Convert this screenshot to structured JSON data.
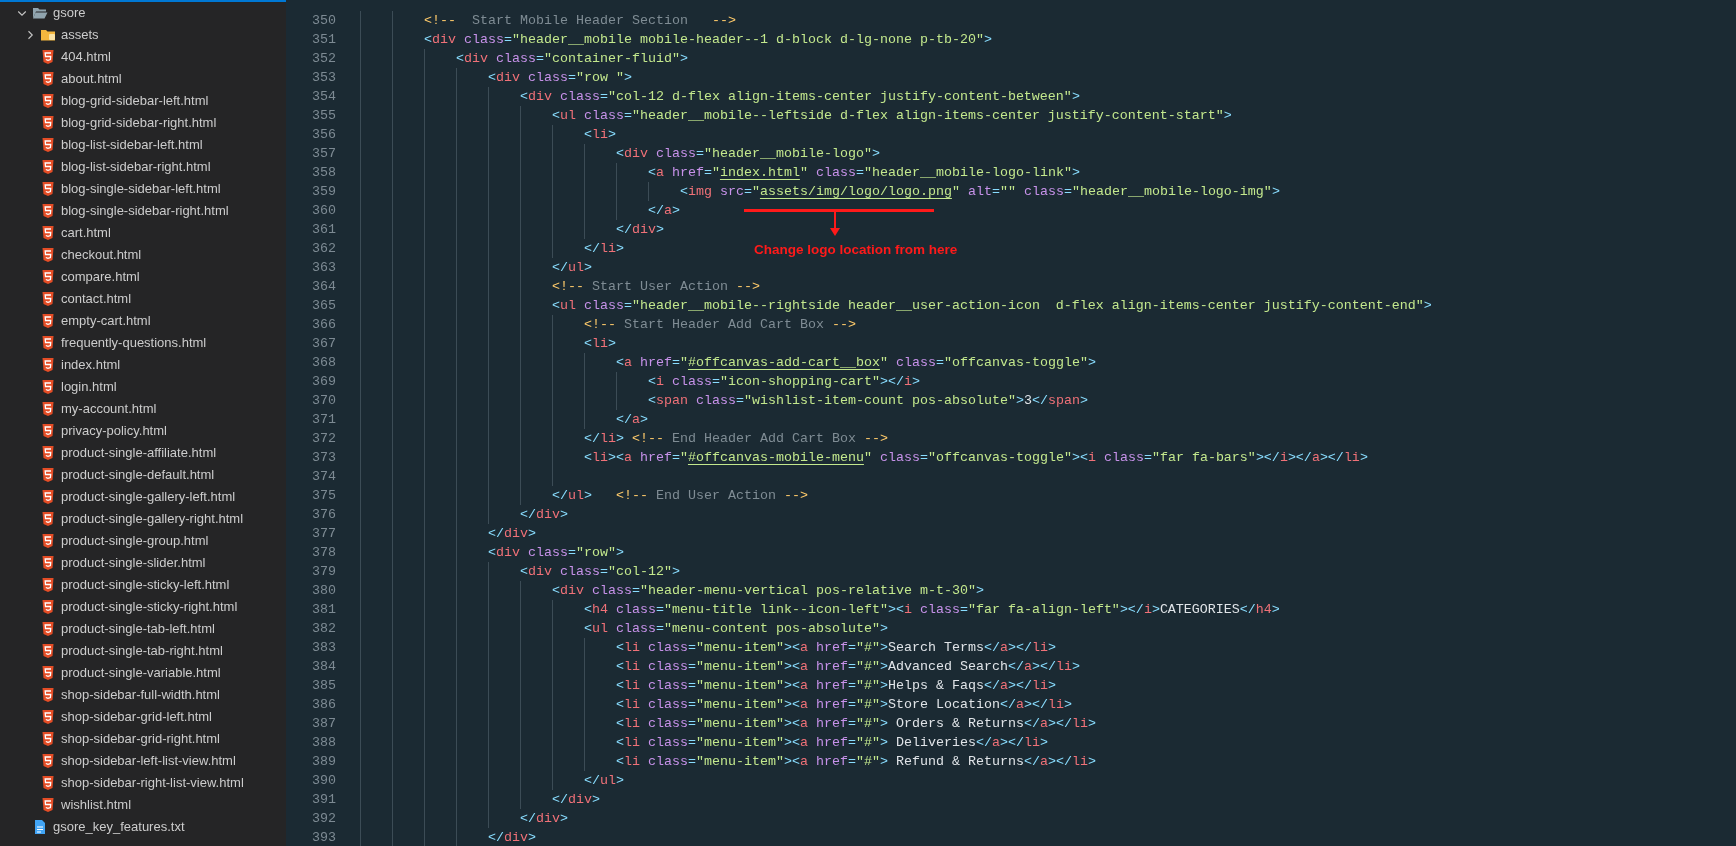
{
  "explorer": {
    "items": [
      {
        "kind": "folder",
        "label": "gsore",
        "expanded": true,
        "children": [
          {
            "kind": "folder",
            "label": "assets",
            "expanded": false
          },
          {
            "kind": "html",
            "label": "404.html"
          },
          {
            "kind": "html",
            "label": "about.html"
          },
          {
            "kind": "html",
            "label": "blog-grid-sidebar-left.html"
          },
          {
            "kind": "html",
            "label": "blog-grid-sidebar-right.html"
          },
          {
            "kind": "html",
            "label": "blog-list-sidebar-left.html"
          },
          {
            "kind": "html",
            "label": "blog-list-sidebar-right.html"
          },
          {
            "kind": "html",
            "label": "blog-single-sidebar-left.html"
          },
          {
            "kind": "html",
            "label": "blog-single-sidebar-right.html"
          },
          {
            "kind": "html",
            "label": "cart.html"
          },
          {
            "kind": "html",
            "label": "checkout.html"
          },
          {
            "kind": "html",
            "label": "compare.html"
          },
          {
            "kind": "html",
            "label": "contact.html"
          },
          {
            "kind": "html",
            "label": "empty-cart.html"
          },
          {
            "kind": "html",
            "label": "frequently-questions.html"
          },
          {
            "kind": "html",
            "label": "index.html"
          },
          {
            "kind": "html",
            "label": "login.html"
          },
          {
            "kind": "html",
            "label": "my-account.html"
          },
          {
            "kind": "html",
            "label": "privacy-policy.html"
          },
          {
            "kind": "html",
            "label": "product-single-affiliate.html"
          },
          {
            "kind": "html",
            "label": "product-single-default.html"
          },
          {
            "kind": "html",
            "label": "product-single-gallery-left.html"
          },
          {
            "kind": "html",
            "label": "product-single-gallery-right.html"
          },
          {
            "kind": "html",
            "label": "product-single-group.html"
          },
          {
            "kind": "html",
            "label": "product-single-slider.html"
          },
          {
            "kind": "html",
            "label": "product-single-sticky-left.html"
          },
          {
            "kind": "html",
            "label": "product-single-sticky-right.html"
          },
          {
            "kind": "html",
            "label": "product-single-tab-left.html"
          },
          {
            "kind": "html",
            "label": "product-single-tab-right.html"
          },
          {
            "kind": "html",
            "label": "product-single-variable.html"
          },
          {
            "kind": "html",
            "label": "shop-sidebar-full-width.html"
          },
          {
            "kind": "html",
            "label": "shop-sidebar-grid-left.html"
          },
          {
            "kind": "html",
            "label": "shop-sidebar-grid-right.html"
          },
          {
            "kind": "html",
            "label": "shop-sidebar-left-list-view.html"
          },
          {
            "kind": "html",
            "label": "shop-sidebar-right-list-view.html"
          },
          {
            "kind": "html",
            "label": "wishlist.html"
          }
        ]
      },
      {
        "kind": "text",
        "label": "gsore_key_features.txt"
      }
    ]
  },
  "editor": {
    "lines": [
      {
        "number": "350",
        "code": [
          {
            "kind": "c",
            "text": "        <!--"
          },
          {
            "kind": "ct",
            "text": "  Start Mobile Header Section   "
          },
          {
            "kind": "c",
            "text": "-->"
          }
        ]
      },
      {
        "number": "351",
        "code": [
          {
            "kind": "p",
            "text": "        <"
          },
          {
            "kind": "t",
            "text": "div"
          },
          {
            "kind": "a",
            "text": " class"
          },
          {
            "kind": "p",
            "text": "="
          },
          {
            "kind": "s",
            "text": "\"header__mobile mobile-header--1 d-block d-lg-none p-tb-20\""
          },
          {
            "kind": "p",
            "text": ">"
          }
        ]
      },
      {
        "number": "352",
        "code": [
          {
            "kind": "p",
            "text": "            <"
          },
          {
            "kind": "t",
            "text": "div"
          },
          {
            "kind": "a",
            "text": " class"
          },
          {
            "kind": "p",
            "text": "="
          },
          {
            "kind": "s",
            "text": "\"container-fluid\""
          },
          {
            "kind": "p",
            "text": ">"
          }
        ]
      },
      {
        "number": "353",
        "code": [
          {
            "kind": "p",
            "text": "                <"
          },
          {
            "kind": "t",
            "text": "div"
          },
          {
            "kind": "a",
            "text": " class"
          },
          {
            "kind": "p",
            "text": "="
          },
          {
            "kind": "s",
            "text": "\"row \""
          },
          {
            "kind": "p",
            "text": ">"
          }
        ]
      },
      {
        "number": "354",
        "code": [
          {
            "kind": "p",
            "text": "                    <"
          },
          {
            "kind": "t",
            "text": "div"
          },
          {
            "kind": "a",
            "text": " class"
          },
          {
            "kind": "p",
            "text": "="
          },
          {
            "kind": "s",
            "text": "\"col-12 d-flex align-items-center justify-content-between\""
          },
          {
            "kind": "p",
            "text": ">"
          }
        ]
      },
      {
        "number": "355",
        "code": [
          {
            "kind": "p",
            "text": "                        <"
          },
          {
            "kind": "t",
            "text": "ul"
          },
          {
            "kind": "a",
            "text": " class"
          },
          {
            "kind": "p",
            "text": "="
          },
          {
            "kind": "s",
            "text": "\"header__mobile--leftside d-flex align-items-center justify-content-start\""
          },
          {
            "kind": "p",
            "text": ">"
          }
        ]
      },
      {
        "number": "356",
        "code": [
          {
            "kind": "p",
            "text": "                            <"
          },
          {
            "kind": "t",
            "text": "li"
          },
          {
            "kind": "p",
            "text": ">"
          }
        ]
      },
      {
        "number": "357",
        "code": [
          {
            "kind": "p",
            "text": "                                <"
          },
          {
            "kind": "t",
            "text": "div"
          },
          {
            "kind": "a",
            "text": " class"
          },
          {
            "kind": "p",
            "text": "="
          },
          {
            "kind": "s",
            "text": "\"header__mobile-logo\""
          },
          {
            "kind": "p",
            "text": ">"
          }
        ]
      },
      {
        "number": "358",
        "code": [
          {
            "kind": "p",
            "text": "                                    <"
          },
          {
            "kind": "t",
            "text": "a"
          },
          {
            "kind": "a",
            "text": " href"
          },
          {
            "kind": "p",
            "text": "="
          },
          {
            "kind": "s",
            "text": "\""
          },
          {
            "kind": "u",
            "text": "index.html"
          },
          {
            "kind": "s",
            "text": "\""
          },
          {
            "kind": "a",
            "text": " class"
          },
          {
            "kind": "p",
            "text": "="
          },
          {
            "kind": "s",
            "text": "\"header__mobile-logo-link\""
          },
          {
            "kind": "p",
            "text": ">"
          }
        ]
      },
      {
        "number": "359",
        "code": [
          {
            "kind": "p",
            "text": "                                        <"
          },
          {
            "kind": "t",
            "text": "img"
          },
          {
            "kind": "a",
            "text": " src"
          },
          {
            "kind": "p",
            "text": "="
          },
          {
            "kind": "s",
            "text": "\""
          },
          {
            "kind": "u",
            "text": "assets/img/logo/logo.png"
          },
          {
            "kind": "s",
            "text": "\""
          },
          {
            "kind": "a",
            "text": " alt"
          },
          {
            "kind": "p",
            "text": "="
          },
          {
            "kind": "s",
            "text": "\"\""
          },
          {
            "kind": "a",
            "text": " class"
          },
          {
            "kind": "p",
            "text": "="
          },
          {
            "kind": "s",
            "text": "\"header__mobile-logo-img\""
          },
          {
            "kind": "p",
            "text": ">"
          }
        ]
      },
      {
        "number": "360",
        "code": [
          {
            "kind": "p",
            "text": "                                    </"
          },
          {
            "kind": "t",
            "text": "a"
          },
          {
            "kind": "p",
            "text": ">"
          }
        ]
      },
      {
        "number": "361",
        "code": [
          {
            "kind": "p",
            "text": "                                </"
          },
          {
            "kind": "t",
            "text": "div"
          },
          {
            "kind": "p",
            "text": ">"
          }
        ]
      },
      {
        "number": "362",
        "code": [
          {
            "kind": "p",
            "text": "                            </"
          },
          {
            "kind": "t",
            "text": "li"
          },
          {
            "kind": "p",
            "text": ">"
          }
        ]
      },
      {
        "number": "363",
        "code": [
          {
            "kind": "p",
            "text": "                        </"
          },
          {
            "kind": "t",
            "text": "ul"
          },
          {
            "kind": "p",
            "text": ">"
          }
        ]
      },
      {
        "number": "364",
        "code": [
          {
            "kind": "c",
            "text": "                        <!--"
          },
          {
            "kind": "ct",
            "text": " Start User Action "
          },
          {
            "kind": "c",
            "text": "-->"
          }
        ]
      },
      {
        "number": "365",
        "code": [
          {
            "kind": "p",
            "text": "                        <"
          },
          {
            "kind": "t",
            "text": "ul"
          },
          {
            "kind": "a",
            "text": " class"
          },
          {
            "kind": "p",
            "text": "="
          },
          {
            "kind": "s",
            "text": "\"header__mobile--rightside header__user-action-icon  d-flex align-items-center justify-content-end\""
          },
          {
            "kind": "p",
            "text": ">"
          }
        ]
      },
      {
        "number": "366",
        "code": [
          {
            "kind": "c",
            "text": "                            <!--"
          },
          {
            "kind": "ct",
            "text": " Start Header Add Cart Box "
          },
          {
            "kind": "c",
            "text": "-->"
          }
        ]
      },
      {
        "number": "367",
        "code": [
          {
            "kind": "p",
            "text": "                            <"
          },
          {
            "kind": "t",
            "text": "li"
          },
          {
            "kind": "p",
            "text": ">"
          }
        ]
      },
      {
        "number": "368",
        "code": [
          {
            "kind": "p",
            "text": "                                <"
          },
          {
            "kind": "t",
            "text": "a"
          },
          {
            "kind": "a",
            "text": " href"
          },
          {
            "kind": "p",
            "text": "="
          },
          {
            "kind": "s",
            "text": "\""
          },
          {
            "kind": "u",
            "text": "#offcanvas-add-cart__box"
          },
          {
            "kind": "s",
            "text": "\""
          },
          {
            "kind": "a",
            "text": " class"
          },
          {
            "kind": "p",
            "text": "="
          },
          {
            "kind": "s",
            "text": "\"offcanvas-toggle\""
          },
          {
            "kind": "p",
            "text": ">"
          }
        ]
      },
      {
        "number": "369",
        "code": [
          {
            "kind": "p",
            "text": "                                    <"
          },
          {
            "kind": "t",
            "text": "i"
          },
          {
            "kind": "a",
            "text": " class"
          },
          {
            "kind": "p",
            "text": "="
          },
          {
            "kind": "s",
            "text": "\"icon-shopping-cart\""
          },
          {
            "kind": "p",
            "text": "></"
          },
          {
            "kind": "t",
            "text": "i"
          },
          {
            "kind": "p",
            "text": ">"
          }
        ]
      },
      {
        "number": "370",
        "code": [
          {
            "kind": "p",
            "text": "                                    <"
          },
          {
            "kind": "t",
            "text": "span"
          },
          {
            "kind": "a",
            "text": " class"
          },
          {
            "kind": "p",
            "text": "="
          },
          {
            "kind": "s",
            "text": "\"wishlist-item-count pos-absolute\""
          },
          {
            "kind": "p",
            "text": ">"
          },
          {
            "kind": "x",
            "text": "3"
          },
          {
            "kind": "p",
            "text": "</"
          },
          {
            "kind": "t",
            "text": "span"
          },
          {
            "kind": "p",
            "text": ">"
          }
        ]
      },
      {
        "number": "371",
        "code": [
          {
            "kind": "p",
            "text": "                                </"
          },
          {
            "kind": "t",
            "text": "a"
          },
          {
            "kind": "p",
            "text": ">"
          }
        ]
      },
      {
        "number": "372",
        "code": [
          {
            "kind": "p",
            "text": "                            </"
          },
          {
            "kind": "t",
            "text": "li"
          },
          {
            "kind": "p",
            "text": "> "
          },
          {
            "kind": "c",
            "text": "<!--"
          },
          {
            "kind": "ct",
            "text": " End Header Add Cart Box "
          },
          {
            "kind": "c",
            "text": "-->"
          }
        ]
      },
      {
        "number": "373",
        "code": [
          {
            "kind": "p",
            "text": "                            <"
          },
          {
            "kind": "t",
            "text": "li"
          },
          {
            "kind": "p",
            "text": "><"
          },
          {
            "kind": "t",
            "text": "a"
          },
          {
            "kind": "a",
            "text": " href"
          },
          {
            "kind": "p",
            "text": "="
          },
          {
            "kind": "s",
            "text": "\""
          },
          {
            "kind": "u",
            "text": "#offcanvas-mobile-menu"
          },
          {
            "kind": "s",
            "text": "\""
          },
          {
            "kind": "a",
            "text": " class"
          },
          {
            "kind": "p",
            "text": "="
          },
          {
            "kind": "s",
            "text": "\"offcanvas-toggle\""
          },
          {
            "kind": "p",
            "text": "><"
          },
          {
            "kind": "t",
            "text": "i"
          },
          {
            "kind": "a",
            "text": " class"
          },
          {
            "kind": "p",
            "text": "="
          },
          {
            "kind": "s",
            "text": "\"far fa-bars\""
          },
          {
            "kind": "p",
            "text": "></"
          },
          {
            "kind": "t",
            "text": "i"
          },
          {
            "kind": "p",
            "text": "></"
          },
          {
            "kind": "t",
            "text": "a"
          },
          {
            "kind": "p",
            "text": "></"
          },
          {
            "kind": "t",
            "text": "li"
          },
          {
            "kind": "p",
            "text": ">"
          }
        ]
      },
      {
        "number": "374"
      },
      {
        "number": "375",
        "code": [
          {
            "kind": "p",
            "text": "                        </"
          },
          {
            "kind": "t",
            "text": "ul"
          },
          {
            "kind": "p",
            "text": ">   "
          },
          {
            "kind": "c",
            "text": "<!--"
          },
          {
            "kind": "ct",
            "text": " End User Action "
          },
          {
            "kind": "c",
            "text": "-->"
          }
        ]
      },
      {
        "number": "376",
        "code": [
          {
            "kind": "p",
            "text": "                    </"
          },
          {
            "kind": "t",
            "text": "div"
          },
          {
            "kind": "p",
            "text": ">"
          }
        ]
      },
      {
        "number": "377",
        "code": [
          {
            "kind": "p",
            "text": "                </"
          },
          {
            "kind": "t",
            "text": "div"
          },
          {
            "kind": "p",
            "text": ">"
          }
        ]
      },
      {
        "number": "378",
        "code": [
          {
            "kind": "p",
            "text": "                <"
          },
          {
            "kind": "t",
            "text": "div"
          },
          {
            "kind": "a",
            "text": " class"
          },
          {
            "kind": "p",
            "text": "="
          },
          {
            "kind": "s",
            "text": "\"row\""
          },
          {
            "kind": "p",
            "text": ">"
          }
        ]
      },
      {
        "number": "379",
        "code": [
          {
            "kind": "p",
            "text": "                    <"
          },
          {
            "kind": "t",
            "text": "div"
          },
          {
            "kind": "a",
            "text": " class"
          },
          {
            "kind": "p",
            "text": "="
          },
          {
            "kind": "s",
            "text": "\"col-12\""
          },
          {
            "kind": "p",
            "text": ">"
          }
        ]
      },
      {
        "number": "380",
        "code": [
          {
            "kind": "p",
            "text": "                        <"
          },
          {
            "kind": "t",
            "text": "div"
          },
          {
            "kind": "a",
            "text": " class"
          },
          {
            "kind": "p",
            "text": "="
          },
          {
            "kind": "s",
            "text": "\"header-menu-vertical pos-relative m-t-30\""
          },
          {
            "kind": "p",
            "text": ">"
          }
        ]
      },
      {
        "number": "381",
        "code": [
          {
            "kind": "p",
            "text": "                            <"
          },
          {
            "kind": "t",
            "text": "h4"
          },
          {
            "kind": "a",
            "text": " class"
          },
          {
            "kind": "p",
            "text": "="
          },
          {
            "kind": "s",
            "text": "\"menu-title link--icon-left\""
          },
          {
            "kind": "p",
            "text": "><"
          },
          {
            "kind": "t",
            "text": "i"
          },
          {
            "kind": "a",
            "text": " class"
          },
          {
            "kind": "p",
            "text": "="
          },
          {
            "kind": "s",
            "text": "\"far fa-align-left\""
          },
          {
            "kind": "p",
            "text": "></"
          },
          {
            "kind": "t",
            "text": "i"
          },
          {
            "kind": "p",
            "text": ">"
          },
          {
            "kind": "x",
            "text": "CATEGORIES"
          },
          {
            "kind": "p",
            "text": "</"
          },
          {
            "kind": "t",
            "text": "h4"
          },
          {
            "kind": "p",
            "text": ">"
          }
        ]
      },
      {
        "number": "382",
        "code": [
          {
            "kind": "p",
            "text": "                            <"
          },
          {
            "kind": "t",
            "text": "ul"
          },
          {
            "kind": "a",
            "text": " class"
          },
          {
            "kind": "p",
            "text": "="
          },
          {
            "kind": "s",
            "text": "\"menu-content pos-absolute\""
          },
          {
            "kind": "p",
            "text": ">"
          }
        ]
      },
      {
        "number": "383",
        "code": [
          {
            "kind": "p",
            "text": "                                <"
          },
          {
            "kind": "t",
            "text": "li"
          },
          {
            "kind": "a",
            "text": " class"
          },
          {
            "kind": "p",
            "text": "="
          },
          {
            "kind": "s",
            "text": "\"menu-item\""
          },
          {
            "kind": "p",
            "text": "><"
          },
          {
            "kind": "t",
            "text": "a"
          },
          {
            "kind": "a",
            "text": " href"
          },
          {
            "kind": "p",
            "text": "="
          },
          {
            "kind": "s",
            "text": "\"#\""
          },
          {
            "kind": "p",
            "text": ">"
          },
          {
            "kind": "x",
            "text": "Search Terms"
          },
          {
            "kind": "p",
            "text": "</"
          },
          {
            "kind": "t",
            "text": "a"
          },
          {
            "kind": "p",
            "text": "></"
          },
          {
            "kind": "t",
            "text": "li"
          },
          {
            "kind": "p",
            "text": ">"
          }
        ]
      },
      {
        "number": "384",
        "code": [
          {
            "kind": "p",
            "text": "                                <"
          },
          {
            "kind": "t",
            "text": "li"
          },
          {
            "kind": "a",
            "text": " class"
          },
          {
            "kind": "p",
            "text": "="
          },
          {
            "kind": "s",
            "text": "\"menu-item\""
          },
          {
            "kind": "p",
            "text": "><"
          },
          {
            "kind": "t",
            "text": "a"
          },
          {
            "kind": "a",
            "text": " href"
          },
          {
            "kind": "p",
            "text": "="
          },
          {
            "kind": "s",
            "text": "\"#\""
          },
          {
            "kind": "p",
            "text": ">"
          },
          {
            "kind": "x",
            "text": "Advanced Search"
          },
          {
            "kind": "p",
            "text": "</"
          },
          {
            "kind": "t",
            "text": "a"
          },
          {
            "kind": "p",
            "text": "></"
          },
          {
            "kind": "t",
            "text": "li"
          },
          {
            "kind": "p",
            "text": ">"
          }
        ]
      },
      {
        "number": "385",
        "code": [
          {
            "kind": "p",
            "text": "                                <"
          },
          {
            "kind": "t",
            "text": "li"
          },
          {
            "kind": "a",
            "text": " class"
          },
          {
            "kind": "p",
            "text": "="
          },
          {
            "kind": "s",
            "text": "\"menu-item\""
          },
          {
            "kind": "p",
            "text": "><"
          },
          {
            "kind": "t",
            "text": "a"
          },
          {
            "kind": "a",
            "text": " href"
          },
          {
            "kind": "p",
            "text": "="
          },
          {
            "kind": "s",
            "text": "\"#\""
          },
          {
            "kind": "p",
            "text": ">"
          },
          {
            "kind": "x",
            "text": "Helps & Faqs"
          },
          {
            "kind": "p",
            "text": "</"
          },
          {
            "kind": "t",
            "text": "a"
          },
          {
            "kind": "p",
            "text": "></"
          },
          {
            "kind": "t",
            "text": "li"
          },
          {
            "kind": "p",
            "text": ">"
          }
        ]
      },
      {
        "number": "386",
        "code": [
          {
            "kind": "p",
            "text": "                                <"
          },
          {
            "kind": "t",
            "text": "li"
          },
          {
            "kind": "a",
            "text": " class"
          },
          {
            "kind": "p",
            "text": "="
          },
          {
            "kind": "s",
            "text": "\"menu-item\""
          },
          {
            "kind": "p",
            "text": "><"
          },
          {
            "kind": "t",
            "text": "a"
          },
          {
            "kind": "a",
            "text": " href"
          },
          {
            "kind": "p",
            "text": "="
          },
          {
            "kind": "s",
            "text": "\"#\""
          },
          {
            "kind": "p",
            "text": ">"
          },
          {
            "kind": "x",
            "text": "Store Location"
          },
          {
            "kind": "p",
            "text": "</"
          },
          {
            "kind": "t",
            "text": "a"
          },
          {
            "kind": "p",
            "text": "></"
          },
          {
            "kind": "t",
            "text": "li"
          },
          {
            "kind": "p",
            "text": ">"
          }
        ]
      },
      {
        "number": "387",
        "code": [
          {
            "kind": "p",
            "text": "                                <"
          },
          {
            "kind": "t",
            "text": "li"
          },
          {
            "kind": "a",
            "text": " class"
          },
          {
            "kind": "p",
            "text": "="
          },
          {
            "kind": "s",
            "text": "\"menu-item\""
          },
          {
            "kind": "p",
            "text": "><"
          },
          {
            "kind": "t",
            "text": "a"
          },
          {
            "kind": "a",
            "text": " href"
          },
          {
            "kind": "p",
            "text": "="
          },
          {
            "kind": "s",
            "text": "\"#\""
          },
          {
            "kind": "p",
            "text": ">"
          },
          {
            "kind": "x",
            "text": " Orders & Returns"
          },
          {
            "kind": "p",
            "text": "</"
          },
          {
            "kind": "t",
            "text": "a"
          },
          {
            "kind": "p",
            "text": "></"
          },
          {
            "kind": "t",
            "text": "li"
          },
          {
            "kind": "p",
            "text": ">"
          }
        ]
      },
      {
        "number": "388",
        "code": [
          {
            "kind": "p",
            "text": "                                <"
          },
          {
            "kind": "t",
            "text": "li"
          },
          {
            "kind": "a",
            "text": " class"
          },
          {
            "kind": "p",
            "text": "="
          },
          {
            "kind": "s",
            "text": "\"menu-item\""
          },
          {
            "kind": "p",
            "text": "><"
          },
          {
            "kind": "t",
            "text": "a"
          },
          {
            "kind": "a",
            "text": " href"
          },
          {
            "kind": "p",
            "text": "="
          },
          {
            "kind": "s",
            "text": "\"#\""
          },
          {
            "kind": "p",
            "text": ">"
          },
          {
            "kind": "x",
            "text": " Deliveries"
          },
          {
            "kind": "p",
            "text": "</"
          },
          {
            "kind": "t",
            "text": "a"
          },
          {
            "kind": "p",
            "text": "></"
          },
          {
            "kind": "t",
            "text": "li"
          },
          {
            "kind": "p",
            "text": ">"
          }
        ]
      },
      {
        "number": "389",
        "code": [
          {
            "kind": "p",
            "text": "                                <"
          },
          {
            "kind": "t",
            "text": "li"
          },
          {
            "kind": "a",
            "text": " class"
          },
          {
            "kind": "p",
            "text": "="
          },
          {
            "kind": "s",
            "text": "\"menu-item\""
          },
          {
            "kind": "p",
            "text": "><"
          },
          {
            "kind": "t",
            "text": "a"
          },
          {
            "kind": "a",
            "text": " href"
          },
          {
            "kind": "p",
            "text": "="
          },
          {
            "kind": "s",
            "text": "\"#\""
          },
          {
            "kind": "p",
            "text": ">"
          },
          {
            "kind": "x",
            "text": " Refund & Returns"
          },
          {
            "kind": "p",
            "text": "</"
          },
          {
            "kind": "t",
            "text": "a"
          },
          {
            "kind": "p",
            "text": "></"
          },
          {
            "kind": "t",
            "text": "li"
          },
          {
            "kind": "p",
            "text": ">"
          }
        ]
      },
      {
        "number": "390",
        "code": [
          {
            "kind": "p",
            "text": "                            </"
          },
          {
            "kind": "t",
            "text": "ul"
          },
          {
            "kind": "p",
            "text": ">"
          }
        ]
      },
      {
        "number": "391",
        "code": [
          {
            "kind": "p",
            "text": "                        </"
          },
          {
            "kind": "t",
            "text": "div"
          },
          {
            "kind": "p",
            "text": ">"
          }
        ]
      },
      {
        "number": "392",
        "code": [
          {
            "kind": "p",
            "text": "                    </"
          },
          {
            "kind": "t",
            "text": "div"
          },
          {
            "kind": "p",
            "text": ">"
          }
        ]
      },
      {
        "number": "393",
        "code": [
          {
            "kind": "p",
            "text": "                </"
          },
          {
            "kind": "t",
            "text": "div"
          },
          {
            "kind": "p",
            "text": ">"
          }
        ]
      }
    ],
    "annotation": {
      "text": "Change logo location from here"
    }
  }
}
